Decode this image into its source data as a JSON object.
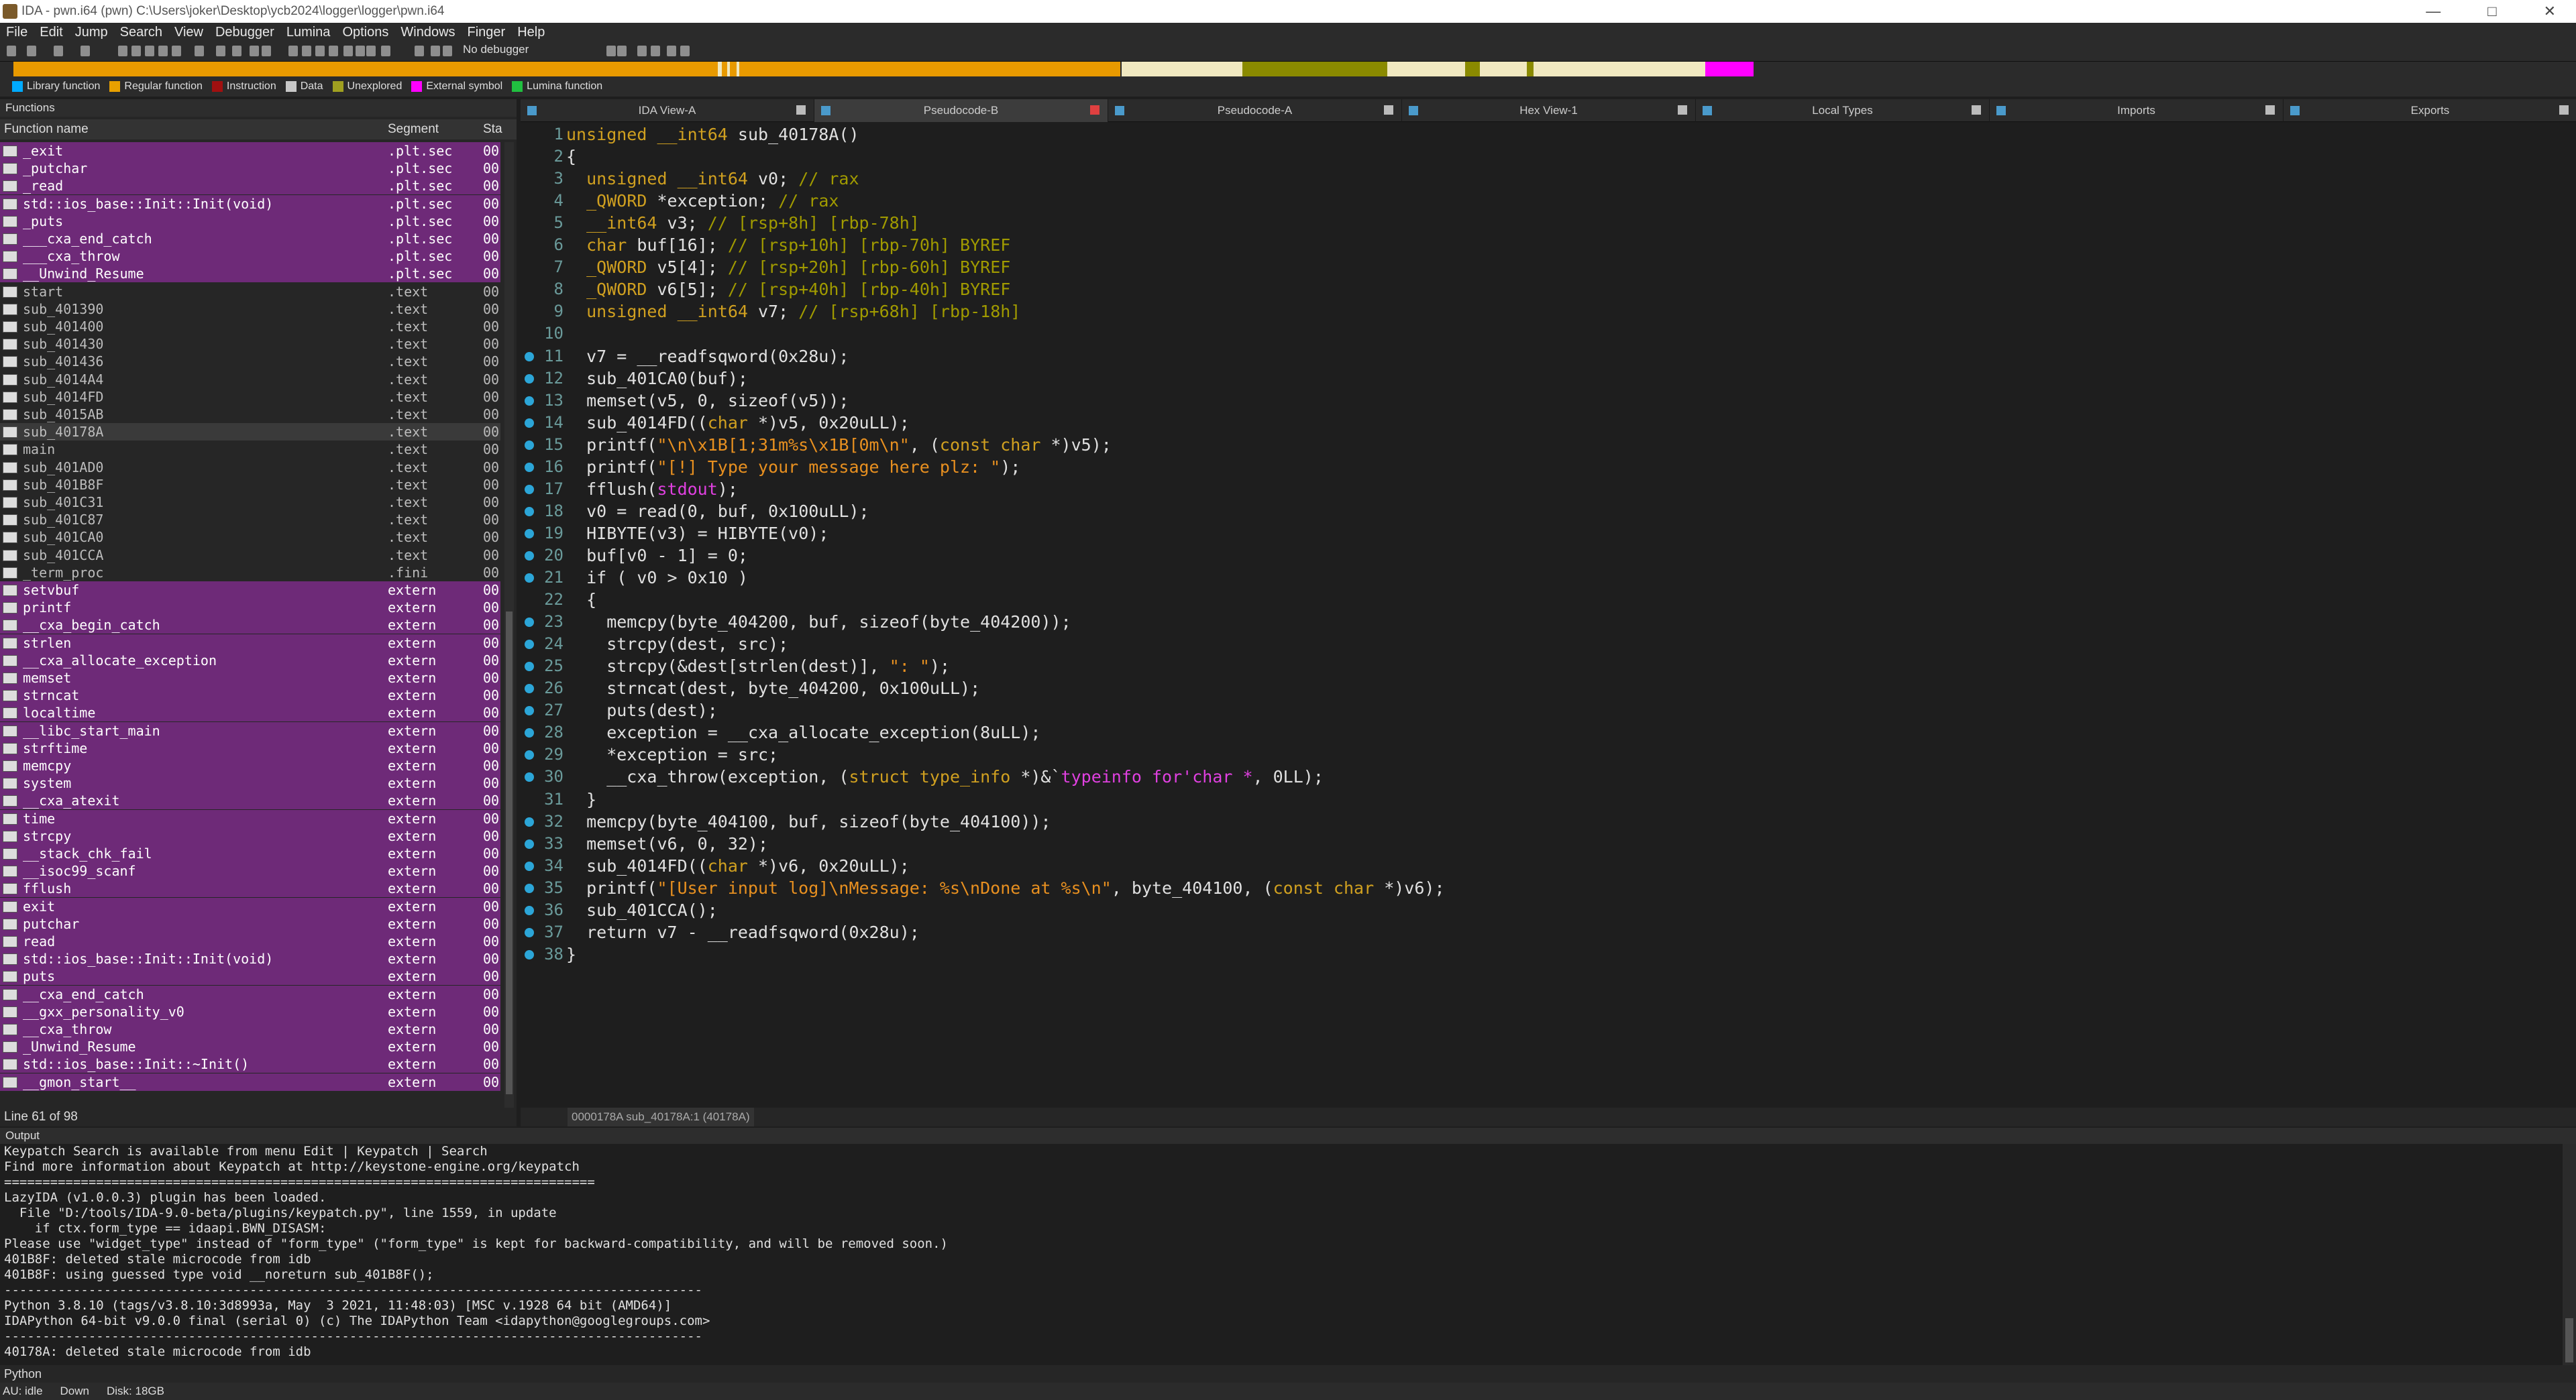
{
  "window": {
    "title": "IDA - pwn.i64 (pwn) C:\\Users\\joker\\Desktop\\ycb2024\\logger\\logger\\pwn.i64"
  },
  "menu": [
    "File",
    "Edit",
    "Jump",
    "Search",
    "View",
    "Debugger",
    "Lumina",
    "Options",
    "Windows",
    "Finger",
    "Help"
  ],
  "toolbar": {
    "debugger": "No debugger"
  },
  "legend": [
    {
      "label": "Library function",
      "color": "#00aaff"
    },
    {
      "label": "Regular function",
      "color": "#e8a000"
    },
    {
      "label": "Instruction",
      "color": "#a01010"
    },
    {
      "label": "Data",
      "color": "#c8c8c8"
    },
    {
      "label": "Unexplored",
      "color": "#a0a020"
    },
    {
      "label": "External symbol",
      "color": "#ff00ff"
    },
    {
      "label": "Lumina function",
      "color": "#20c040"
    }
  ],
  "functions": {
    "title": "Functions",
    "headers": {
      "name": "Function name",
      "segment": "Segment",
      "start": "Sta"
    },
    "rows": [
      {
        "name": "_exit",
        "seg": ".plt.sec",
        "st": "00",
        "kind": "plt"
      },
      {
        "name": "_putchar",
        "seg": ".plt.sec",
        "st": "00",
        "kind": "plt"
      },
      {
        "name": "_read",
        "seg": ".plt.sec",
        "st": "00",
        "kind": "plt"
      },
      {
        "name": "std::ios_base::Init::Init(void)",
        "seg": ".plt.sec",
        "st": "00",
        "kind": "plt"
      },
      {
        "name": "_puts",
        "seg": ".plt.sec",
        "st": "00",
        "kind": "plt"
      },
      {
        "name": "___cxa_end_catch",
        "seg": ".plt.sec",
        "st": "00",
        "kind": "plt"
      },
      {
        "name": "___cxa_throw",
        "seg": ".plt.sec",
        "st": "00",
        "kind": "plt"
      },
      {
        "name": "__Unwind_Resume",
        "seg": ".plt.sec",
        "st": "00",
        "kind": "plt"
      },
      {
        "name": "start",
        "seg": ".text",
        "st": "00",
        "kind": "text"
      },
      {
        "name": "sub_401390",
        "seg": ".text",
        "st": "00",
        "kind": "text"
      },
      {
        "name": "sub_401400",
        "seg": ".text",
        "st": "00",
        "kind": "text"
      },
      {
        "name": "sub_401430",
        "seg": ".text",
        "st": "00",
        "kind": "text"
      },
      {
        "name": "sub_401436",
        "seg": ".text",
        "st": "00",
        "kind": "text"
      },
      {
        "name": "sub_4014A4",
        "seg": ".text",
        "st": "00",
        "kind": "text"
      },
      {
        "name": "sub_4014FD",
        "seg": ".text",
        "st": "00",
        "kind": "text"
      },
      {
        "name": "sub_4015AB",
        "seg": ".text",
        "st": "00",
        "kind": "text"
      },
      {
        "name": "sub_40178A",
        "seg": ".text",
        "st": "00",
        "kind": "sel"
      },
      {
        "name": "main",
        "seg": ".text",
        "st": "00",
        "kind": "text"
      },
      {
        "name": "sub_401AD0",
        "seg": ".text",
        "st": "00",
        "kind": "text"
      },
      {
        "name": "sub_401B8F",
        "seg": ".text",
        "st": "00",
        "kind": "text"
      },
      {
        "name": "sub_401C31",
        "seg": ".text",
        "st": "00",
        "kind": "text"
      },
      {
        "name": "sub_401C87",
        "seg": ".text",
        "st": "00",
        "kind": "text"
      },
      {
        "name": "sub_401CA0",
        "seg": ".text",
        "st": "00",
        "kind": "text"
      },
      {
        "name": "sub_401CCA",
        "seg": ".text",
        "st": "00",
        "kind": "text"
      },
      {
        "name": "_term_proc",
        "seg": ".fini",
        "st": "00",
        "kind": "text"
      },
      {
        "name": "setvbuf",
        "seg": "extern",
        "st": "00",
        "kind": "ext"
      },
      {
        "name": "printf",
        "seg": "extern",
        "st": "00",
        "kind": "ext"
      },
      {
        "name": "__cxa_begin_catch",
        "seg": "extern",
        "st": "00",
        "kind": "ext"
      },
      {
        "name": "strlen",
        "seg": "extern",
        "st": "00",
        "kind": "ext"
      },
      {
        "name": "__cxa_allocate_exception",
        "seg": "extern",
        "st": "00",
        "kind": "ext"
      },
      {
        "name": "memset",
        "seg": "extern",
        "st": "00",
        "kind": "ext"
      },
      {
        "name": "strncat",
        "seg": "extern",
        "st": "00",
        "kind": "ext"
      },
      {
        "name": "localtime",
        "seg": "extern",
        "st": "00",
        "kind": "ext"
      },
      {
        "name": "__libc_start_main",
        "seg": "extern",
        "st": "00",
        "kind": "ext"
      },
      {
        "name": "strftime",
        "seg": "extern",
        "st": "00",
        "kind": "ext"
      },
      {
        "name": "memcpy",
        "seg": "extern",
        "st": "00",
        "kind": "ext"
      },
      {
        "name": "system",
        "seg": "extern",
        "st": "00",
        "kind": "ext"
      },
      {
        "name": "__cxa_atexit",
        "seg": "extern",
        "st": "00",
        "kind": "ext"
      },
      {
        "name": "time",
        "seg": "extern",
        "st": "00",
        "kind": "ext"
      },
      {
        "name": "strcpy",
        "seg": "extern",
        "st": "00",
        "kind": "ext"
      },
      {
        "name": "__stack_chk_fail",
        "seg": "extern",
        "st": "00",
        "kind": "ext"
      },
      {
        "name": "__isoc99_scanf",
        "seg": "extern",
        "st": "00",
        "kind": "ext"
      },
      {
        "name": "fflush",
        "seg": "extern",
        "st": "00",
        "kind": "ext"
      },
      {
        "name": "exit",
        "seg": "extern",
        "st": "00",
        "kind": "ext"
      },
      {
        "name": "putchar",
        "seg": "extern",
        "st": "00",
        "kind": "ext"
      },
      {
        "name": "read",
        "seg": "extern",
        "st": "00",
        "kind": "ext"
      },
      {
        "name": "std::ios_base::Init::Init(void)",
        "seg": "extern",
        "st": "00",
        "kind": "ext"
      },
      {
        "name": "puts",
        "seg": "extern",
        "st": "00",
        "kind": "ext"
      },
      {
        "name": "__cxa_end_catch",
        "seg": "extern",
        "st": "00",
        "kind": "ext"
      },
      {
        "name": "__gxx_personality_v0",
        "seg": "extern",
        "st": "00",
        "kind": "ext"
      },
      {
        "name": "__cxa_throw",
        "seg": "extern",
        "st": "00",
        "kind": "ext"
      },
      {
        "name": "_Unwind_Resume",
        "seg": "extern",
        "st": "00",
        "kind": "ext"
      },
      {
        "name": "std::ios_base::Init::~Init()",
        "seg": "extern",
        "st": "00",
        "kind": "ext"
      },
      {
        "name": "__gmon_start__",
        "seg": "extern",
        "st": "00",
        "kind": "ext"
      }
    ],
    "status": "Line 61 of 98"
  },
  "tabs": [
    {
      "label": "IDA View-A",
      "active": false
    },
    {
      "label": "Pseudocode-B",
      "active": true
    },
    {
      "label": "Pseudocode-A",
      "active": false
    },
    {
      "label": "Hex View-1",
      "active": false
    },
    {
      "label": "Local Types",
      "active": false
    },
    {
      "label": "Imports",
      "active": false
    },
    {
      "label": "Exports",
      "active": false
    }
  ],
  "code": [
    {
      "n": "1",
      "dot": false,
      "html": "<span class='ty'>unsigned __int64</span> <span class='fn2'>sub_40178A</span>()"
    },
    {
      "n": "2",
      "dot": false,
      "html": "{"
    },
    {
      "n": "3",
      "dot": false,
      "html": "  <span class='ty'>unsigned __int64</span> <span class='gl'>v0</span>; <span class='cm'>// rax</span>"
    },
    {
      "n": "4",
      "dot": false,
      "html": "  <span class='ty'>_QWORD</span> *<span class='gl'>exception</span>; <span class='cm'>// rax</span>"
    },
    {
      "n": "5",
      "dot": false,
      "html": "  <span class='ty'>__int64</span> <span class='gl'>v3</span>; <span class='cm'>// [rsp+8h] [rbp-78h]</span>"
    },
    {
      "n": "6",
      "dot": false,
      "html": "  <span class='ty'>char</span> <span class='gl'>buf</span>[16]; <span class='cm'>// [rsp+10h] [rbp-70h] BYREF</span>"
    },
    {
      "n": "7",
      "dot": false,
      "html": "  <span class='ty'>_QWORD</span> <span class='gl'>v5</span>[4]; <span class='cm'>// [rsp+20h] [rbp-60h] BYREF</span>"
    },
    {
      "n": "8",
      "dot": false,
      "html": "  <span class='ty'>_QWORD</span> <span class='gl'>v6</span>[5]; <span class='cm'>// [rsp+40h] [rbp-40h] BYREF</span>"
    },
    {
      "n": "9",
      "dot": false,
      "html": "  <span class='ty'>unsigned __int64</span> <span class='gl'>v7</span>; <span class='cm'>// [rsp+68h] [rbp-18h]</span>"
    },
    {
      "n": "10",
      "dot": false,
      "html": ""
    },
    {
      "n": "11",
      "dot": true,
      "html": "  <span class='gl'>v7</span> = __readfsqword(0x28u);"
    },
    {
      "n": "12",
      "dot": true,
      "html": "  sub_401CA0(<span class='gl'>buf</span>);"
    },
    {
      "n": "13",
      "dot": true,
      "html": "  memset(<span class='gl'>v5</span>, 0, sizeof(<span class='gl'>v5</span>));"
    },
    {
      "n": "14",
      "dot": true,
      "html": "  sub_4014FD((<span class='ty'>char</span> *)<span class='gl'>v5</span>, 0x20uLL);"
    },
    {
      "n": "15",
      "dot": true,
      "html": "  printf(<span class='st2'>\"\\n\\x1B[1;31m%s\\x1B[0m\\n\"</span>, (<span class='ty'>const char</span> *)<span class='gl'>v5</span>);"
    },
    {
      "n": "16",
      "dot": true,
      "html": "  printf(<span class='st2'>\"[!] Type your message here plz: \"</span>);"
    },
    {
      "n": "17",
      "dot": true,
      "html": "  fflush(<span style='color:#e040e0'>stdout</span>);"
    },
    {
      "n": "18",
      "dot": true,
      "html": "  <span class='gl'>v0</span> = read(0, <span class='gl'>buf</span>, 0x100uLL);"
    },
    {
      "n": "19",
      "dot": true,
      "html": "  HIBYTE(<span class='gl'>v3</span>) = HIBYTE(<span class='gl'>v0</span>);"
    },
    {
      "n": "20",
      "dot": true,
      "html": "  <span class='gl'>buf</span>[<span class='gl'>v0</span> - 1] = 0;"
    },
    {
      "n": "21",
      "dot": true,
      "html": "  if ( <span class='gl'>v0</span> &gt; 0x10 )"
    },
    {
      "n": "22",
      "dot": false,
      "html": "  {"
    },
    {
      "n": "23",
      "dot": true,
      "html": "    memcpy(<span class='gl'>byte_404200</span>, <span class='gl'>buf</span>, sizeof(<span class='gl'>byte_404200</span>));"
    },
    {
      "n": "24",
      "dot": true,
      "html": "    strcpy(<span class='gl'>dest</span>, <span class='gl'>src</span>);"
    },
    {
      "n": "25",
      "dot": true,
      "html": "    strcpy(&amp;<span class='gl'>dest</span>[strlen(<span class='gl'>dest</span>)], <span class='st2'>\": \"</span>);"
    },
    {
      "n": "26",
      "dot": true,
      "html": "    strncat(<span class='gl'>dest</span>, <span class='gl'>byte_404200</span>, 0x100uLL);"
    },
    {
      "n": "27",
      "dot": true,
      "html": "    puts(<span class='gl'>dest</span>);"
    },
    {
      "n": "28",
      "dot": true,
      "html": "    <span class='gl'>exception</span> = __cxa_allocate_exception(8uLL);"
    },
    {
      "n": "29",
      "dot": true,
      "html": "    *<span class='gl'>exception</span> = <span class='gl'>src</span>;"
    },
    {
      "n": "30",
      "dot": true,
      "html": "    __cxa_throw(<span class='gl'>exception</span>, (<span class='ty'>struct type_info</span> *)&amp;`<span style='color:#e040e0'>typeinfo for'char *</span>, 0LL);"
    },
    {
      "n": "31",
      "dot": false,
      "html": "  }"
    },
    {
      "n": "32",
      "dot": true,
      "html": "  memcpy(<span class='gl'>byte_404100</span>, <span class='gl'>buf</span>, sizeof(<span class='gl'>byte_404100</span>));"
    },
    {
      "n": "33",
      "dot": true,
      "html": "  memset(<span class='gl'>v6</span>, 0, 32);"
    },
    {
      "n": "34",
      "dot": true,
      "html": "  sub_4014FD((<span class='ty'>char</span> *)<span class='gl'>v6</span>, 0x20uLL);"
    },
    {
      "n": "35",
      "dot": true,
      "html": "  printf(<span class='st2'>\"[User input log]\\nMessage: %s\\nDone at %s\\n\"</span>, <span class='gl'>byte_404100</span>, (<span class='ty'>const char</span> *)<span class='gl'>v6</span>);"
    },
    {
      "n": "36",
      "dot": true,
      "html": "  sub_401CCA();"
    },
    {
      "n": "37",
      "dot": true,
      "html": "  return <span class='gl'>v7</span> - __readfsqword(0x28u);"
    },
    {
      "n": "38",
      "dot": true,
      "html": "}"
    }
  ],
  "code_status": "0000178A sub_40178A:1 (40178A)",
  "output": {
    "title": "Output",
    "lines": [
      "Keypatch Search is available from menu Edit | Keypatch | Search",
      "Find more information about Keypatch at http://keystone-engine.org/keypatch",
      "=============================================================================",
      "LazyIDA (v1.0.0.3) plugin has been loaded.",
      "  File \"D:/tools/IDA-9.0-beta/plugins/keypatch.py\", line 1559, in update",
      "    if ctx.form_type == idaapi.BWN_DISASM:",
      "Please use \"widget_type\" instead of \"form_type\" (\"form_type\" is kept for backward-compatibility, and will be removed soon.)",
      "401B8F: deleted stale microcode from idb",
      "401B8F: using guessed type void __noreturn sub_401B8F();",
      "-------------------------------------------------------------------------------------------",
      "Python 3.8.10 (tags/v3.8.10:3d8993a, May  3 2021, 11:48:03) [MSC v.1928 64 bit (AMD64)]",
      "IDAPython 64-bit v9.0.0 final (serial 0) (c) The IDAPython Team <idapython@googlegroups.com>",
      "-------------------------------------------------------------------------------------------",
      "40178A: deleted stale microcode from idb"
    ],
    "prompt": "Python"
  },
  "statusbar": {
    "au": "AU:  idle",
    "dir": "Down",
    "disk": "Disk: 18GB"
  }
}
